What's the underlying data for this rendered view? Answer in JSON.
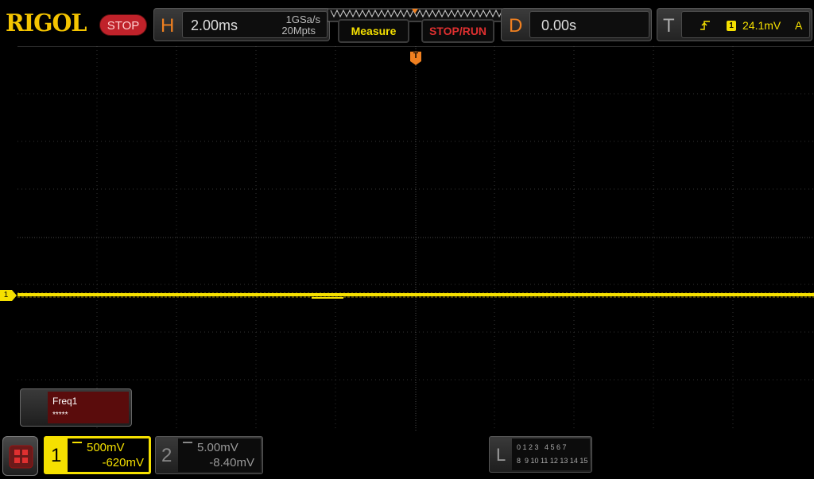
{
  "header": {
    "brand": "RIGOL",
    "run_state": "STOP",
    "horizontal": {
      "letter": "H",
      "timebase": "2.00ms",
      "sample_rate": "1GSa/s",
      "memory_depth": "20Mpts"
    },
    "measure_button": "Measure",
    "stop_run_button": "STOP/RUN",
    "delay": {
      "letter": "D",
      "value": "0.00s"
    },
    "trigger": {
      "letter": "T",
      "source": "1",
      "level": "24.1mV",
      "mode": "A"
    }
  },
  "screen": {
    "trigger_marker": "T",
    "ch1_marker": "1",
    "measurement": {
      "name": "Freq1",
      "value": "*****"
    }
  },
  "footer": {
    "ch1": {
      "num": "1",
      "scale": "500mV",
      "offset": "-620mV"
    },
    "ch2": {
      "num": "2",
      "scale": "5.00mV",
      "offset": "-8.40mV"
    },
    "logic": {
      "letter": "L",
      "row1": "0 1 2 3   4 5 6 7",
      "row2": "8  9 10 11 12 13 14 15"
    }
  },
  "colors": {
    "ch1": "#f5e000",
    "orange": "#f08020",
    "red": "#e03030",
    "measure_text": "#f5e000"
  }
}
